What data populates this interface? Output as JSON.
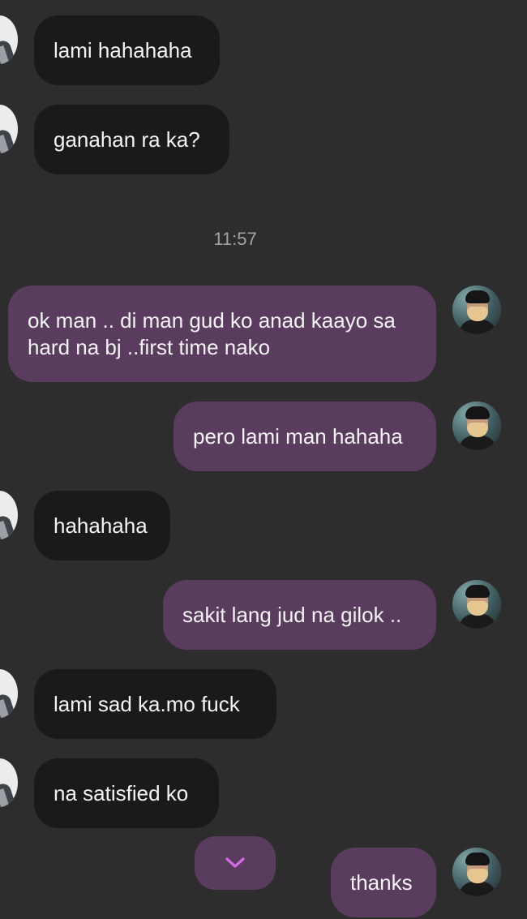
{
  "conversation": {
    "timestamp": "11:57",
    "messages": [
      {
        "from": "them",
        "text": "lami hahahaha"
      },
      {
        "from": "them",
        "text": "ganahan ra ka?"
      },
      {
        "from": "me",
        "text": "ok man .. di man gud ko anad kaayo sa hard na bj ..first time nako"
      },
      {
        "from": "me",
        "text": "pero lami man hahaha"
      },
      {
        "from": "them",
        "text": "hahahaha"
      },
      {
        "from": "me",
        "text": "sakit lang jud na gilok .."
      },
      {
        "from": "them",
        "text": "lami sad ka.mo fuck"
      },
      {
        "from": "them",
        "text": "na satisfied ko"
      },
      {
        "from": "me",
        "text": "thanks"
      }
    ]
  },
  "icons": {
    "scroll_down": "chevron-down-icon"
  },
  "colors": {
    "background": "#2d2d2d",
    "incoming_bubble": "#1a1a1a",
    "outgoing_bubble": "#5a3c5e",
    "accent": "#d46ce6"
  }
}
